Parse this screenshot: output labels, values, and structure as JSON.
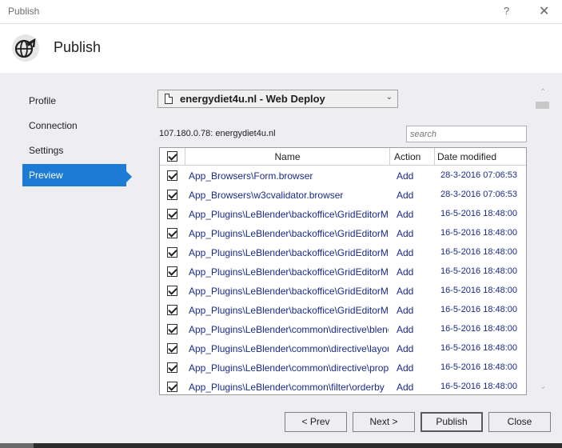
{
  "window": {
    "title": "Publish",
    "help_glyph": "?",
    "close_glyph": "✕"
  },
  "header": {
    "title": "Publish",
    "icon": "globe-publish-icon"
  },
  "nav": {
    "items": [
      {
        "label": "Profile",
        "active": false
      },
      {
        "label": "Connection",
        "active": false
      },
      {
        "label": "Settings",
        "active": false
      },
      {
        "label": "Preview",
        "active": true
      }
    ]
  },
  "profile": {
    "selected": "energydiet4u.nl - Web Deploy"
  },
  "server_label": "107.180.0.78: energydiet4u.nl",
  "search": {
    "placeholder": "search",
    "value": ""
  },
  "table": {
    "headers": {
      "name": "Name",
      "action": "Action",
      "date": "Date modified"
    },
    "rows": [
      {
        "checked": true,
        "name": "App_Browsers\\Form.browser",
        "action": "Add",
        "date": "28-3-2016 07:06:53"
      },
      {
        "checked": true,
        "name": "App_Browsers\\w3cvalidator.browser",
        "action": "Add",
        "date": "28-3-2016 07:06:53"
      },
      {
        "checked": true,
        "name": "App_Plugins\\LeBlender\\backoffice\\GridEditorManager",
        "action": "Add",
        "date": "16-5-2016 18:48:00"
      },
      {
        "checked": true,
        "name": "App_Plugins\\LeBlender\\backoffice\\GridEditorManager",
        "action": "Add",
        "date": "16-5-2016 18:48:00"
      },
      {
        "checked": true,
        "name": "App_Plugins\\LeBlender\\backoffice\\GridEditorManager",
        "action": "Add",
        "date": "16-5-2016 18:48:00"
      },
      {
        "checked": true,
        "name": "App_Plugins\\LeBlender\\backoffice\\GridEditorManager",
        "action": "Add",
        "date": "16-5-2016 18:48:00"
      },
      {
        "checked": true,
        "name": "App_Plugins\\LeBlender\\backoffice\\GridEditorManager",
        "action": "Add",
        "date": "16-5-2016 18:48:00"
      },
      {
        "checked": true,
        "name": "App_Plugins\\LeBlender\\backoffice\\GridEditorManager",
        "action": "Add",
        "date": "16-5-2016 18:48:00"
      },
      {
        "checked": true,
        "name": "App_Plugins\\LeBlender\\common\\directive\\blender",
        "action": "Add",
        "date": "16-5-2016 18:48:00"
      },
      {
        "checked": true,
        "name": "App_Plugins\\LeBlender\\common\\directive\\layout",
        "action": "Add",
        "date": "16-5-2016 18:48:00"
      },
      {
        "checked": true,
        "name": "App_Plugins\\LeBlender\\common\\directive\\property",
        "action": "Add",
        "date": "16-5-2016 18:48:00"
      },
      {
        "checked": true,
        "name": "App_Plugins\\LeBlender\\common\\filter\\orderby",
        "action": "Add",
        "date": "16-5-2016 18:48:00"
      }
    ]
  },
  "buttons": {
    "prev": "< Prev",
    "next": "Next >",
    "publish": "Publish",
    "close": "Close"
  },
  "colors": {
    "accent": "#1c7bd4",
    "link": "#1a2a8c",
    "panel": "#eeeef2"
  }
}
